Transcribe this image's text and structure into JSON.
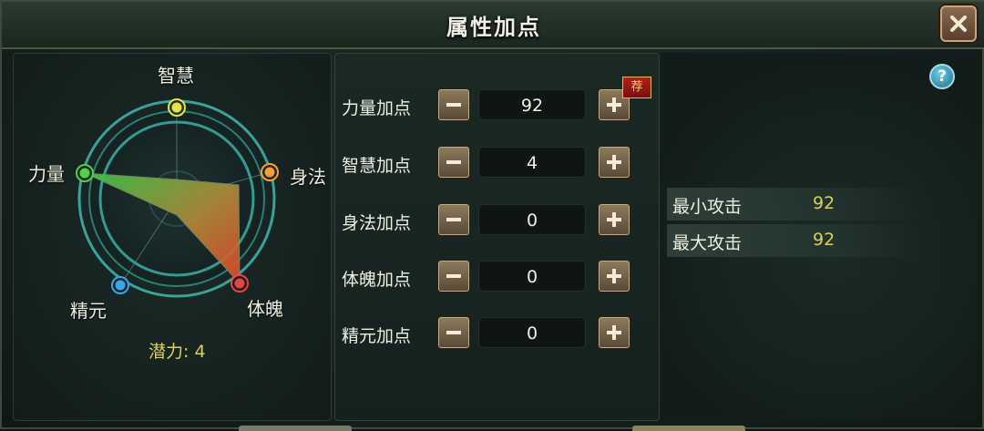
{
  "window": {
    "title": "属性加点"
  },
  "icons": {
    "close": "close-x-icon",
    "help": "question-mark-icon"
  },
  "radar": {
    "axes": [
      {
        "key": "wisdom",
        "label": "智慧",
        "color": "#e4e44a"
      },
      {
        "key": "agility",
        "label": "身法",
        "color": "#f0a040"
      },
      {
        "key": "vitality",
        "label": "体魄",
        "color": "#e04848"
      },
      {
        "key": "essence",
        "label": "精元",
        "color": "#3aa8e8"
      },
      {
        "key": "strength",
        "label": "力量",
        "color": "#50d050"
      }
    ]
  },
  "potential": {
    "text": "潜力: 4",
    "value": 4
  },
  "allocation": {
    "rows": [
      {
        "label": "力量加点",
        "value": "92",
        "recommended": true
      },
      {
        "label": "智慧加点",
        "value": "4",
        "recommended": false
      },
      {
        "label": "身法加点",
        "value": "0",
        "recommended": false
      },
      {
        "label": "体魄加点",
        "value": "0",
        "recommended": false
      },
      {
        "label": "精元加点",
        "value": "0",
        "recommended": false
      }
    ],
    "recommend_badge": "荐"
  },
  "attack": {
    "min_label": "最小攻击",
    "min_value": "92",
    "max_label": "最大攻击",
    "max_value": "92"
  },
  "colors": {
    "accent_yellow": "#d9d25a",
    "button_brown": "#6e5c44",
    "ring_teal": "#39b7b0"
  }
}
